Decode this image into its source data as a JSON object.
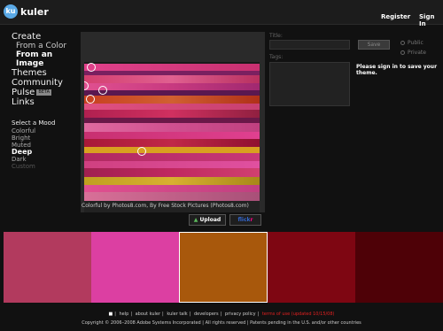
{
  "header": {
    "logo_mark": "ku",
    "app_name": "kuler",
    "register": "Register",
    "sign_in": "Sign In"
  },
  "sidebar": {
    "create": "Create",
    "from_color": "From a Color",
    "from_image": "From an Image",
    "themes": "Themes",
    "community": "Community",
    "pulse": "Pulse",
    "pulse_badge": "BETA",
    "links": "Links",
    "mood_title": "Select a Mood",
    "moods": [
      "Colorful",
      "Bright",
      "Muted",
      "Deep",
      "Dark",
      "Custom"
    ],
    "selected_mood": "Deep"
  },
  "image_panel": {
    "caption": "Colorful by Photos8.com, By Free Stock Pictures (Photos8.com)",
    "upload_label": "Upload",
    "flickr_part1": "flick",
    "flickr_part2": "r"
  },
  "theme_form": {
    "title_label": "Title:",
    "tags_label": "Tags:",
    "save_label": "Save",
    "public_label": "Public",
    "private_label": "Private",
    "signin_message": "Please sign in to save your theme."
  },
  "swatches": [
    {
      "color": "#b23a5e"
    },
    {
      "color": "#dc3fa2"
    },
    {
      "color": "#a8580c"
    },
    {
      "color": "#7e0612"
    },
    {
      "color": "#4e0107"
    }
  ],
  "selected_swatch": 2,
  "footer": {
    "links": [
      "help",
      "about kuler",
      "kuler talk",
      "developers",
      "privacy policy"
    ],
    "terms": "terms of use (updated 10/15/08)",
    "copyright": "Copyright © 2006–2008 Adobe Systems Incorporated | All rights reserved | Patents pending in the U.S. and/or other countries"
  },
  "colors": {
    "background": "#111111",
    "accent_blue": "#5aa9e6",
    "terms_red": "#e02020"
  }
}
